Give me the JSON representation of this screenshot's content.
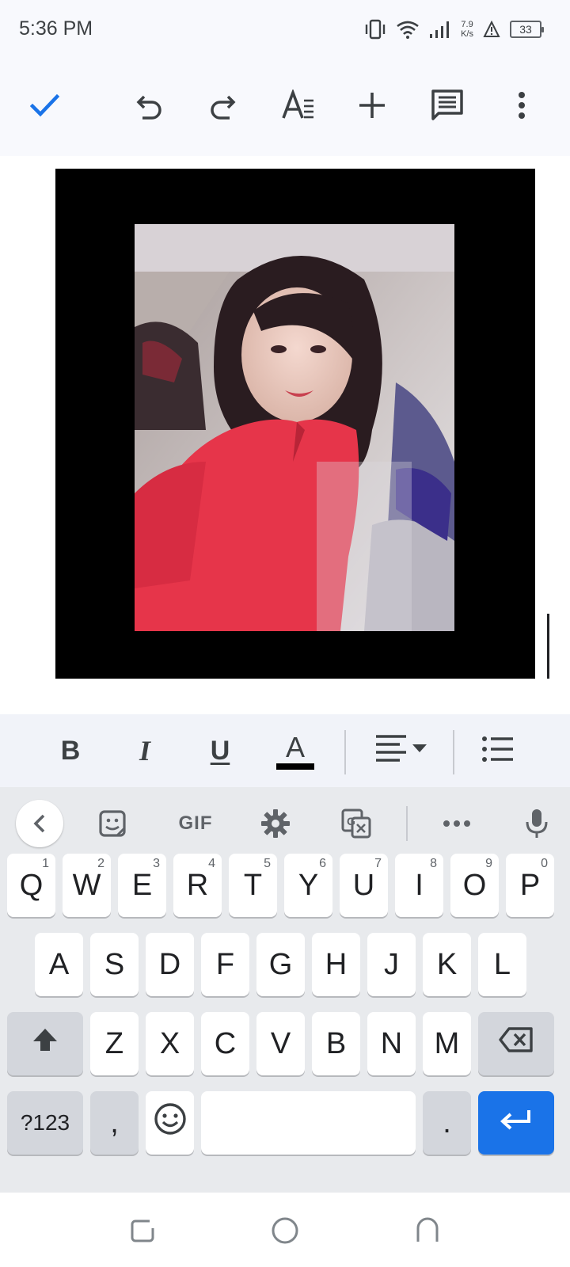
{
  "status_bar": {
    "time": "5:36 PM",
    "net_speed_value": "7.9",
    "net_speed_unit": "K/s",
    "battery_level": "33",
    "icons": [
      "vibrate-icon",
      "wifi-icon",
      "signal-icon",
      "alert-icon",
      "battery-icon"
    ]
  },
  "toolbar": {
    "icons": [
      "check-icon",
      "undo-icon",
      "redo-icon",
      "text-format-icon",
      "insert-plus-icon",
      "comment-icon",
      "more-vert-icon"
    ],
    "accent_color": "#1a73e8"
  },
  "document": {
    "image_description_icon": "portrait-photo"
  },
  "format_bar": {
    "bold": "B",
    "italic": "I",
    "underline": "U",
    "text_color": "A",
    "text_color_value": "#000000",
    "icons": [
      "align-left-icon",
      "bulleted-list-icon"
    ]
  },
  "keyboard": {
    "toolbar": {
      "gif_label": "GIF",
      "icons": [
        "back-chevron-icon",
        "sticker-icon",
        "gear-icon",
        "translate-icon",
        "more-horiz-icon",
        "mic-icon"
      ]
    },
    "row1": [
      {
        "label": "Q",
        "hint": "1"
      },
      {
        "label": "W",
        "hint": "2"
      },
      {
        "label": "E",
        "hint": "3"
      },
      {
        "label": "R",
        "hint": "4"
      },
      {
        "label": "T",
        "hint": "5"
      },
      {
        "label": "Y",
        "hint": "6"
      },
      {
        "label": "U",
        "hint": "7"
      },
      {
        "label": "I",
        "hint": "8"
      },
      {
        "label": "O",
        "hint": "9"
      },
      {
        "label": "P",
        "hint": "0"
      }
    ],
    "row2": [
      "A",
      "S",
      "D",
      "F",
      "G",
      "H",
      "J",
      "K",
      "L"
    ],
    "row3": [
      "Z",
      "X",
      "C",
      "V",
      "B",
      "N",
      "M"
    ],
    "row4": {
      "symbols": "?123",
      "comma": ",",
      "period": "."
    },
    "enter_color": "#1a73e8"
  },
  "nav_bar": {
    "icons": [
      "recents-icon",
      "home-icon",
      "back-icon"
    ]
  }
}
